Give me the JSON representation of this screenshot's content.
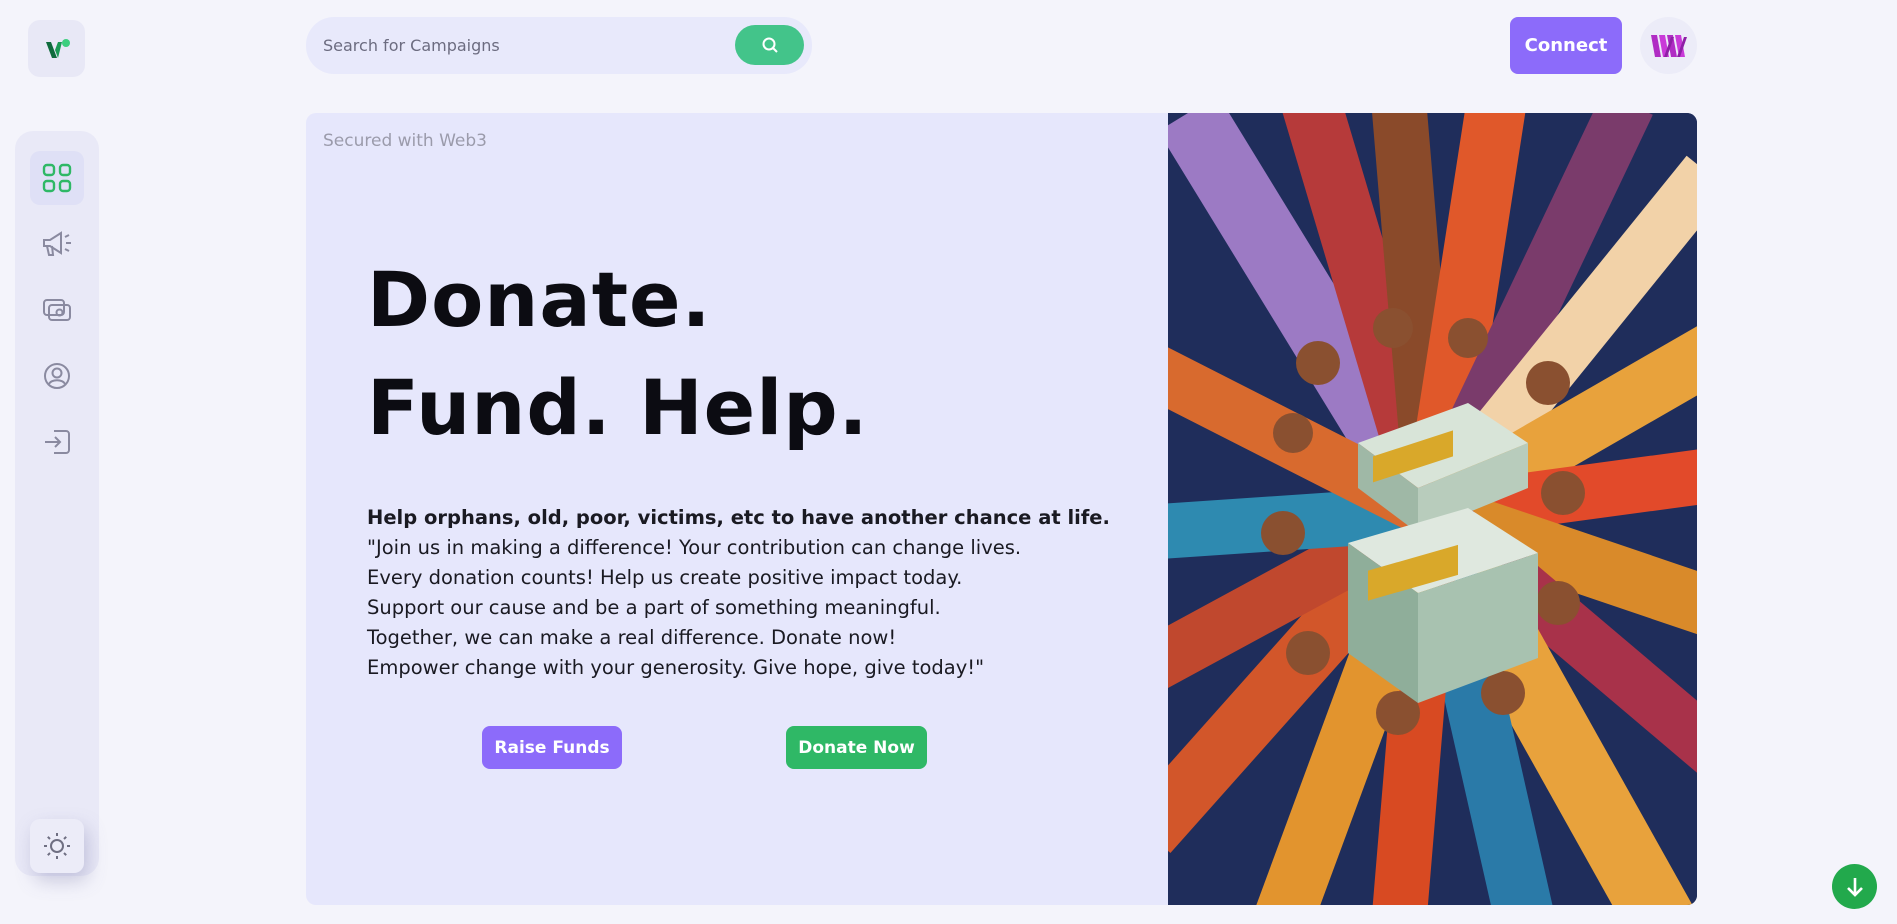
{
  "search": {
    "placeholder": "Search for Campaigns"
  },
  "header": {
    "connect_label": "Connect"
  },
  "hero": {
    "badge": "Secured with Web3",
    "headline_line1": "Donate.",
    "headline_line2": "Fund. Help.",
    "lead": "Help orphans, old, poor, victims, etc to have another chance at life.",
    "lines": [
      "\"Join us in making a difference! Your contribution can change lives.",
      "Every donation counts! Help us create positive impact today.",
      "Support our cause and be a part of something meaningful.",
      "Together, we can make a real difference. Donate now!",
      "Empower change with your generosity. Give hope, give today!\""
    ],
    "raise_label": "Raise Funds",
    "donate_label": "Donate Now"
  },
  "colors": {
    "accent_purple": "#8c6bfa",
    "accent_green": "#2fb866",
    "icon_green": "#35b36e",
    "hero_bg": "#e6e7fc"
  },
  "icons": {
    "logo": "brand-logo-icon",
    "nav": [
      "dashboard-grid-icon",
      "megaphone-icon",
      "payment-icon",
      "profile-icon",
      "logout-icon"
    ],
    "theme": "sun-icon",
    "search": "search-icon",
    "avatar": "brand-avatar-icon",
    "scroll": "arrow-down-icon"
  }
}
